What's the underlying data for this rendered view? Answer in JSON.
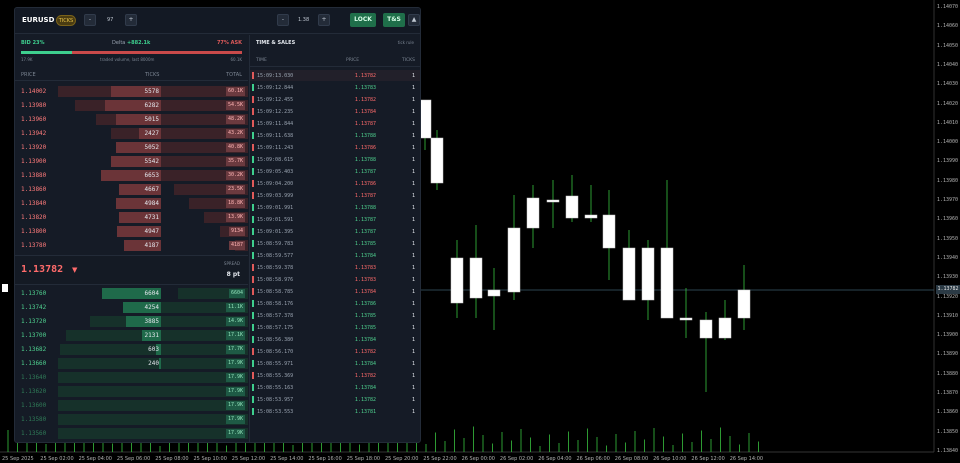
{
  "chart": {
    "price_axis": [
      "1.14070",
      "1.14060",
      "1.14050",
      "1.14040",
      "1.14030",
      "1.14020",
      "1.14010",
      "1.14000",
      "1.13990",
      "1.13980",
      "1.13970",
      "1.13960",
      "1.13950",
      "1.13940",
      "1.13930",
      "1.13920",
      "1.13910",
      "1.13900",
      "1.13890",
      "1.13880",
      "1.13870",
      "1.13860",
      "1.13850",
      "1.13840"
    ],
    "current_price": "1.13782",
    "time_labels": [
      "25 Sep 2025",
      "25 Sep 02:00",
      "25 Sep 04:00",
      "25 Sep 06:00",
      "25 Sep 08:00",
      "25 Sep 10:00",
      "25 Sep 12:00",
      "25 Sep 14:00",
      "25 Sep 16:00",
      "25 Sep 18:00",
      "25 Sep 20:00",
      "25 Sep 22:00",
      "26 Sep 00:00",
      "26 Sep 02:00",
      "26 Sep 04:00",
      "26 Sep 06:00",
      "26 Sep 08:00",
      "26 Sep 10:00",
      "26 Sep 12:00",
      "26 Sep 14:00"
    ],
    "colors": {
      "bull": "#ffffff",
      "wick": "#39c23f",
      "price_line": "#3c5a6a"
    }
  },
  "panel": {
    "symbol": "EURUSD",
    "mode_pill": "TICKS",
    "minus": "-",
    "plus": "+",
    "depth_value": "97",
    "zoom_value": "1.38",
    "lock_label": "LOCK",
    "ts_label": "T&S",
    "collapse_icon": "▲"
  },
  "dom": {
    "bid_pct": "BID 23%",
    "delta_label": "Delta",
    "delta_value": "+882.1k",
    "ask_pct": "77% ASK",
    "bid_fraction": 0.23,
    "vol_left": "17.9K",
    "vol_center": "traded volume, last 8000m",
    "vol_right": "60.1K",
    "headers": {
      "price": "PRICE",
      "ticks": "TICKS",
      "total": "TOTAL"
    },
    "asks": [
      {
        "price": "1.14002",
        "ticks": "5578",
        "total": "60.1K",
        "depth": 1.0
      },
      {
        "price": "1.13980",
        "ticks": "6282",
        "total": "54.5K",
        "depth": 0.91
      },
      {
        "price": "1.13960",
        "ticks": "5015",
        "total": "48.2K",
        "depth": 0.8
      },
      {
        "price": "1.13942",
        "ticks": "2427",
        "total": "43.2K",
        "depth": 0.72
      },
      {
        "price": "1.13920",
        "ticks": "5052",
        "total": "40.8K",
        "depth": 0.68
      },
      {
        "price": "1.13900",
        "ticks": "5542",
        "total": "35.7K",
        "depth": 0.59
      },
      {
        "price": "1.13880",
        "ticks": "6653",
        "total": "30.2K",
        "depth": 0.5
      },
      {
        "price": "1.13860",
        "ticks": "4667",
        "total": "23.5K",
        "depth": 0.39
      },
      {
        "price": "1.13840",
        "ticks": "4984",
        "total": "18.8K",
        "depth": 0.31
      },
      {
        "price": "1.13820",
        "ticks": "4731",
        "total": "13.9K",
        "depth": 0.23
      },
      {
        "price": "1.13800",
        "ticks": "4947",
        "total": "9134",
        "depth": 0.15
      },
      {
        "price": "1.13780",
        "ticks": "4187",
        "total": "4187",
        "depth": 0.07
      }
    ],
    "last_price": "1.13782",
    "last_arrow": "▼",
    "spread_label": "SPREAD",
    "spread_value": "8 pt",
    "bids": [
      {
        "price": "1.13760",
        "ticks": "6604",
        "total": "6604",
        "depth": 0.37
      },
      {
        "price": "1.13742",
        "ticks": "4254",
        "total": "11.1K",
        "depth": 0.62
      },
      {
        "price": "1.13720",
        "ticks": "3885",
        "total": "14.9K",
        "depth": 0.83
      },
      {
        "price": "1.13700",
        "ticks": "2131",
        "total": "17.1K",
        "depth": 0.96
      },
      {
        "price": "1.13682",
        "ticks": "603",
        "total": "17.7K",
        "depth": 0.99
      },
      {
        "price": "1.13660",
        "ticks": "240",
        "total": "17.9K",
        "depth": 1.0
      },
      {
        "price": "1.13640",
        "ticks": "",
        "total": "17.9K",
        "depth": 1.0
      },
      {
        "price": "1.13620",
        "ticks": "",
        "total": "17.9K",
        "depth": 1.0
      },
      {
        "price": "1.13600",
        "ticks": "",
        "total": "17.9K",
        "depth": 1.0
      },
      {
        "price": "1.13580",
        "ticks": "",
        "total": "17.9K",
        "depth": 1.0
      },
      {
        "price": "1.13560",
        "ticks": "",
        "total": "17.9K",
        "depth": 1.0
      },
      {
        "price": "1.13542",
        "ticks": "",
        "total": "17.9K",
        "depth": 1.0
      }
    ]
  },
  "tns": {
    "title": "TIME & SALES",
    "rule": "tick rule",
    "headers": {
      "time": "TIME",
      "price": "PRICE",
      "ticks": "TICKS"
    },
    "trades": [
      {
        "time": "15:09:13.030",
        "price": "1.13782",
        "ticks": "1",
        "side": "sell"
      },
      {
        "time": "15:09:12.844",
        "price": "1.13783",
        "ticks": "1",
        "side": "buy"
      },
      {
        "time": "15:09:12.455",
        "price": "1.13782",
        "ticks": "1",
        "side": "sell"
      },
      {
        "time": "15:09:12.235",
        "price": "1.13784",
        "ticks": "1",
        "side": "sell"
      },
      {
        "time": "15:09:11.844",
        "price": "1.13787",
        "ticks": "1",
        "side": "sell"
      },
      {
        "time": "15:09:11.638",
        "price": "1.13788",
        "ticks": "1",
        "side": "buy"
      },
      {
        "time": "15:09:11.243",
        "price": "1.13786",
        "ticks": "1",
        "side": "sell"
      },
      {
        "time": "15:09:08.615",
        "price": "1.13788",
        "ticks": "1",
        "side": "buy"
      },
      {
        "time": "15:09:05.403",
        "price": "1.13787",
        "ticks": "1",
        "side": "buy"
      },
      {
        "time": "15:09:04.200",
        "price": "1.13786",
        "ticks": "1",
        "side": "sell"
      },
      {
        "time": "15:09:03.999",
        "price": "1.13787",
        "ticks": "1",
        "side": "sell"
      },
      {
        "time": "15:09:01.991",
        "price": "1.13788",
        "ticks": "1",
        "side": "buy"
      },
      {
        "time": "15:09:01.591",
        "price": "1.13787",
        "ticks": "1",
        "side": "buy"
      },
      {
        "time": "15:09:01.395",
        "price": "1.13787",
        "ticks": "1",
        "side": "buy"
      },
      {
        "time": "15:08:59.783",
        "price": "1.13785",
        "ticks": "1",
        "side": "buy"
      },
      {
        "time": "15:08:59.577",
        "price": "1.13784",
        "ticks": "1",
        "side": "buy"
      },
      {
        "time": "15:08:59.378",
        "price": "1.13783",
        "ticks": "1",
        "side": "sell"
      },
      {
        "time": "15:08:58.976",
        "price": "1.13783",
        "ticks": "1",
        "side": "sell"
      },
      {
        "time": "15:08:58.785",
        "price": "1.13784",
        "ticks": "1",
        "side": "sell"
      },
      {
        "time": "15:08:58.176",
        "price": "1.13786",
        "ticks": "1",
        "side": "buy"
      },
      {
        "time": "15:08:57.378",
        "price": "1.13785",
        "ticks": "1",
        "side": "buy"
      },
      {
        "time": "15:08:57.175",
        "price": "1.13785",
        "ticks": "1",
        "side": "buy"
      },
      {
        "time": "15:08:56.380",
        "price": "1.13784",
        "ticks": "1",
        "side": "buy"
      },
      {
        "time": "15:08:56.170",
        "price": "1.13782",
        "ticks": "1",
        "side": "sell"
      },
      {
        "time": "15:08:55.971",
        "price": "1.13784",
        "ticks": "1",
        "side": "buy"
      },
      {
        "time": "15:08:55.369",
        "price": "1.13782",
        "ticks": "1",
        "side": "sell"
      },
      {
        "time": "15:08:55.163",
        "price": "1.13784",
        "ticks": "1",
        "side": "buy"
      },
      {
        "time": "15:08:53.957",
        "price": "1.13782",
        "ticks": "1",
        "side": "buy"
      },
      {
        "time": "15:08:53.553",
        "price": "1.13781",
        "ticks": "1",
        "side": "buy"
      }
    ]
  }
}
